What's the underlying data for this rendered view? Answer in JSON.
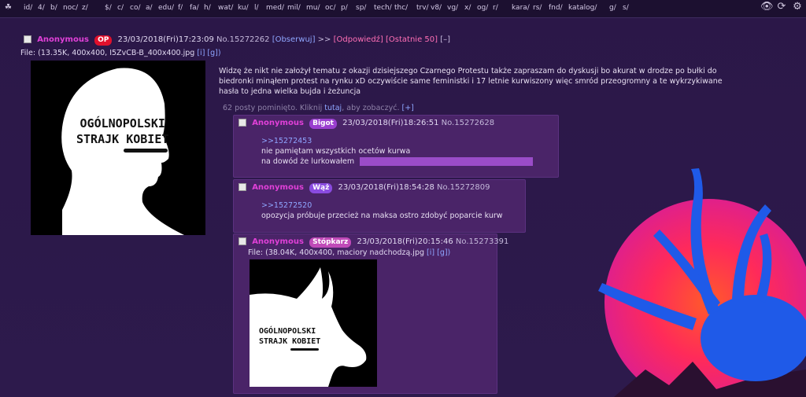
{
  "boards": [
    "id/",
    "4/",
    "b/",
    "noc/",
    "z/",
    "$/",
    "c/",
    "co/",
    "a/",
    "edu/",
    "f/",
    "fa/",
    "h/",
    "wat/",
    "ku/",
    "l/",
    "med/",
    "mil/",
    "mu/",
    "oc/",
    "p/",
    "sp/",
    "tech/",
    "thc/",
    "trv/",
    "v8/",
    "vg/",
    "x/",
    "og/",
    "r/",
    "kara/",
    "rs/",
    "fnd/",
    "katalog/",
    "g/",
    "s/"
  ],
  "icons": {
    "logo": "cat-logo-icon",
    "eye": "eye-icon",
    "refresh": "refresh-icon",
    "settings": "gear-icon"
  },
  "op": {
    "name": "Anonymous",
    "tag": "OP",
    "date": "23/03/2018(Fri)17:23:09",
    "no": "No.15272262",
    "observe": "[Obserwuj]",
    "arrows": ">>",
    "reply": "[Odpowiedź]",
    "last50": "[Ostatnie 50]",
    "collapse": "[–]",
    "file": "File: (13.35K, 400x400, I5ZvCB-B_400x400.jpg",
    "file_links": "[i] [g])",
    "message": "Widzę że nikt nie założył tematu z okazji dzisiejszego Czarnego Protestu także zapraszam do dyskusji bo akurat w drodze po bułki do biedronki minąłem protest na rynku xD oczywiście same feministki i 17 letnie kurwiszony więc smród przeogromny a te wykrzykiwane hasła to jedna wielka bujda i żeżuncja",
    "image_text": [
      "OGÓLNOPOLSKI",
      "STRAJK KOBIET"
    ]
  },
  "omitted": {
    "text": "62 posty pominięto. Kliknij",
    "link": "tutaj",
    "rest": ", aby zobaczyć.",
    "expand": "[+]"
  },
  "replies": [
    {
      "name": "Anonymous",
      "tag": "Bigot",
      "tag_color": "#9a3fd0",
      "date": "23/03/2018(Fri)18:26:51",
      "no": "No.15272628",
      "quote": ">>15272453",
      "lines": [
        "nie pamiętam wszystkich ocetów kurwa",
        "na dowód że lurkowałem"
      ]
    },
    {
      "name": "Anonymous",
      "tag": "Wąż",
      "tag_color": "#8a4be0",
      "date": "23/03/2018(Fri)18:54:28",
      "no": "No.15272809",
      "quote": ">>15272520",
      "lines": [
        "opozycja próbuje przecież na maksa ostro zdobyć poparcie kurw"
      ]
    },
    {
      "name": "Anonymous",
      "tag": "Stópkarz",
      "tag_color": "#c04ab8",
      "date": "23/03/2018(Fri)20:15:46",
      "no": "No.15273391",
      "file": "File: (38.04K, 400x400, maciory nadchodzą.jpg",
      "file_links": "[i] [g])",
      "image_text": [
        "OGÓLNOPOLSKI",
        "STRAJK KOBIET"
      ]
    }
  ]
}
